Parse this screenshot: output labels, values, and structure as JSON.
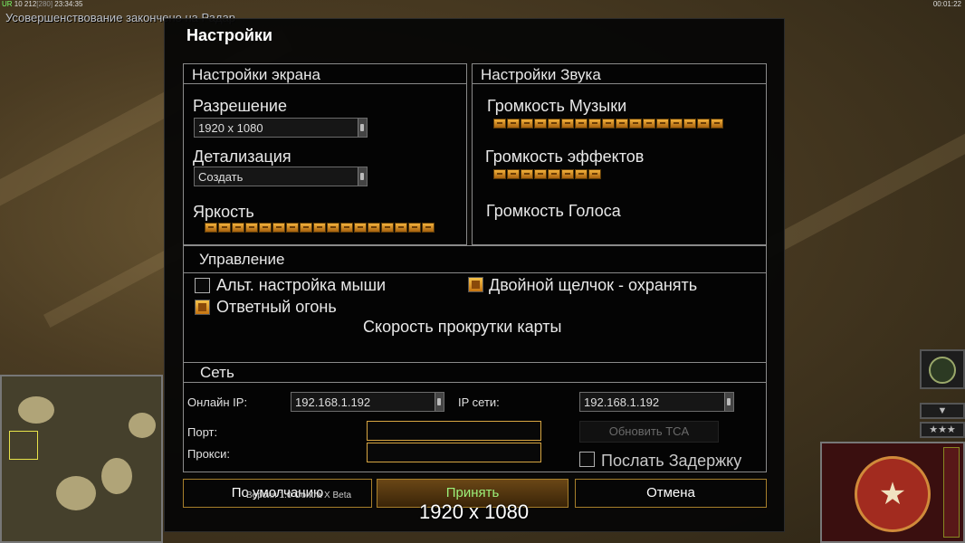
{
  "hud": {
    "left_code": "UR",
    "left_stats": "10 212",
    "left_dim": "[280]",
    "left_time": "23:34:35",
    "right_time": "00:01:22"
  },
  "notice": "Усовершенствование закончено на Радар",
  "dialog": {
    "title": "Настройки",
    "screen": {
      "header": "Настройки экрана",
      "resolution_label": "Разрешение",
      "resolution_value": "1920 x 1080",
      "detail_label": "Детализация",
      "detail_value": "Создать",
      "brightness_label": "Яркость",
      "brightness_level": 1.0
    },
    "sound": {
      "header": "Настройки Звука",
      "music_label": "Громкость Музыки",
      "music_level": 1.0,
      "effects_label": "Громкость эффектов",
      "effects_level": 0.45,
      "voice_label": "Громкость Голоса",
      "voice_level": 0
    },
    "controls": {
      "header": "Управление",
      "alt_mouse_label": "Альт. настройка мыши",
      "alt_mouse_checked": false,
      "double_click_label": "Двойной щелчок - охранять",
      "double_click_checked": true,
      "return_fire_label": "Ответный огонь",
      "return_fire_checked": true,
      "scroll_speed_label": "Скорость прокрутки карты"
    },
    "network": {
      "header": "Сеть",
      "online_ip_label": "Онлайн IP:",
      "online_ip_value": "192.168.1.192",
      "lan_ip_label": "IP сети:",
      "lan_ip_value": "192.168.1.192",
      "port_label": "Порт:",
      "port_value": "",
      "proxy_label": "Прокси:",
      "proxy_value": "",
      "update_button": "Обновить TCA",
      "send_delay_label": "Послать Задержку",
      "send_delay_checked": false
    },
    "buttons": {
      "defaults": "По умолчанию",
      "accept": "Принять",
      "cancel": "Отмена"
    }
  },
  "version_text": "Версия 1.0 Contra X Beta",
  "resolution_overlay": "1920 x 1080",
  "right_hud": {
    "arrow_glyph": "▼",
    "stars_glyph": "★★★",
    "emblem_glyph": "★"
  },
  "colors": {
    "accent_gold": "#d8a642",
    "slider_orange": "#f2b13c",
    "accept_text": "#9cf07a"
  }
}
